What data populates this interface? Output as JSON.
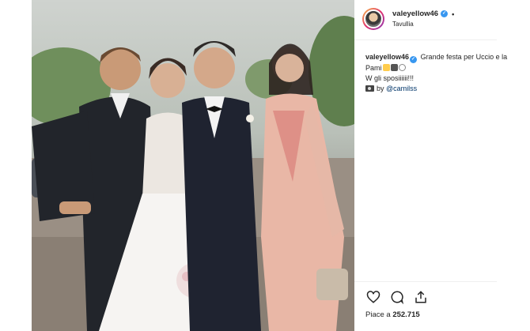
{
  "post": {
    "username": "valeyellow46",
    "more_dot": "•",
    "location": "Tavullia",
    "caption": {
      "username": "valeyellow46",
      "text_line1": "Grande festa per Uccio e la Pami",
      "text_line2": "W gli sposiiiiii!!!",
      "credit_prefix": "by",
      "credit_mention": "@camilss"
    },
    "likes_label": "Piace a",
    "likes_count": "252.715"
  },
  "icons": [
    "heart-icon",
    "comment-icon",
    "share-icon",
    "verified-badge-icon",
    "camera-icon"
  ],
  "colors": {
    "verified": "#3897f0",
    "text": "#262626",
    "mention": "#003569"
  }
}
